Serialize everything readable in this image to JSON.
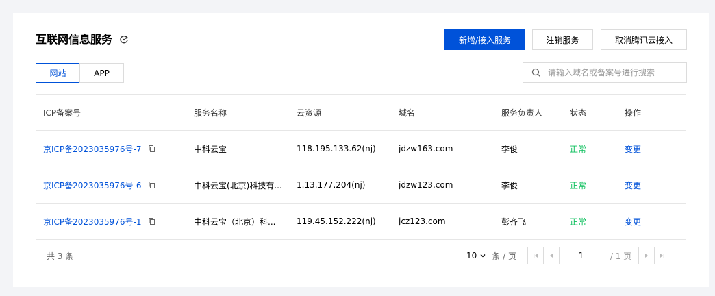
{
  "header": {
    "title": "互联网信息服务",
    "new_button": "新增/接入服务",
    "cancel_button": "注销服务",
    "unlink_button": "取消腾讯云接入"
  },
  "tabs": [
    {
      "label": "网站",
      "active": true
    },
    {
      "label": "APP",
      "active": false
    }
  ],
  "search": {
    "placeholder": "请输入域名或备案号进行搜索"
  },
  "table": {
    "columns": [
      "ICP备案号",
      "服务名称",
      "云资源",
      "域名",
      "服务负责人",
      "状态",
      "操作"
    ],
    "rows": [
      {
        "icp": "京ICP备2023035976号-7",
        "service": "中科云宝",
        "resource": "118.195.133.62(nj)",
        "domain": "jdzw163.com",
        "owner": "李俊",
        "status": "正常",
        "action": "变更"
      },
      {
        "icp": "京ICP备2023035976号-6",
        "service": "中科云宝(北京)科技有...",
        "resource": "1.13.177.204(nj)",
        "domain": "jdzw123.com",
        "owner": "李俊",
        "status": "正常",
        "action": "变更"
      },
      {
        "icp": "京ICP备2023035976号-1",
        "service": "中科云宝（北京）科...",
        "resource": "119.45.152.222(nj)",
        "domain": "jcz123.com",
        "owner": "彭齐飞",
        "status": "正常",
        "action": "变更"
      }
    ]
  },
  "pagination": {
    "total_text": "共 3 条",
    "page_size": "10",
    "page_size_unit": "条 / 页",
    "current_page": "1",
    "total_pages_text": "/ 1 页"
  },
  "colors": {
    "primary": "#0052d9",
    "success": "#0abf5b"
  }
}
